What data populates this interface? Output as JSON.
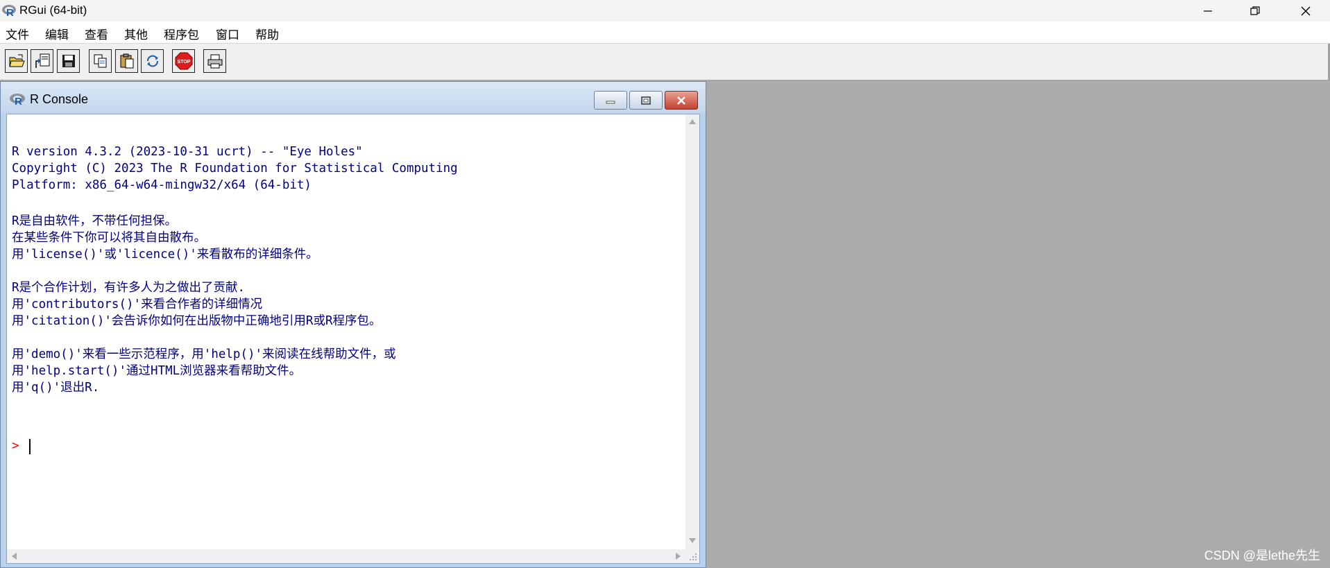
{
  "app": {
    "title": "RGui (64-bit)",
    "window_controls": {
      "minimize": "minimize",
      "maximize": "maximize",
      "close": "close"
    }
  },
  "menubar": {
    "items": [
      "文件",
      "编辑",
      "查看",
      "其他",
      "程序包",
      "窗口",
      "帮助"
    ]
  },
  "toolbar": {
    "buttons": [
      "open-script-icon",
      "load-workspace-icon",
      "save-icon",
      "copy-icon",
      "paste-icon",
      "refresh-icon",
      "stop-icon",
      "print-icon"
    ],
    "stop_label": "STOP"
  },
  "console": {
    "title": "R Console",
    "lines": [
      "R version 4.3.2 (2023-10-31 ucrt) -- \"Eye Holes\"",
      "Copyright (C) 2023 The R Foundation for Statistical Computing",
      "Platform: x86_64-w64-mingw32/x64 (64-bit)",
      "",
      "R是自由软件，不带任何担保。",
      "在某些条件下你可以将其自由散布。",
      "用'license()'或'licence()'来看散布的详细条件。",
      "",
      "R是个合作计划，有许多人为之做出了贡献.",
      "用'contributors()'来看合作者的详细情况",
      "用'citation()'会告诉你如何在出版物中正确地引用R或R程序包。",
      "",
      "用'demo()'来看一些示范程序，用'help()'来阅读在线帮助文件，或",
      "用'help.start()'通过HTML浏览器来看帮助文件。",
      "用'q()'退出R."
    ],
    "prompt": ">"
  },
  "watermark": "CSDN @是lethe先生",
  "colors": {
    "console_text": "#000080",
    "prompt": "#ff0000",
    "mdi_background": "#ababab",
    "child_frame": "#b9d1ea"
  }
}
